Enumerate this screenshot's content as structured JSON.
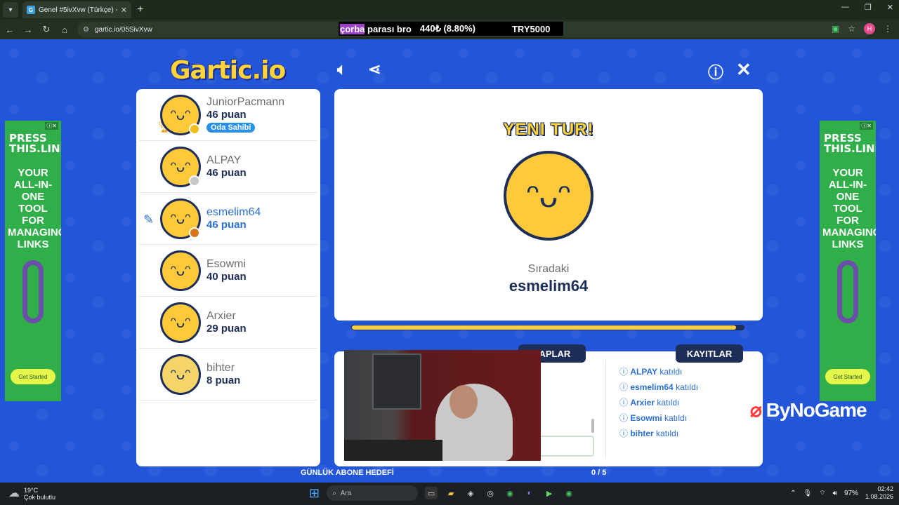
{
  "browser": {
    "tab_title": "Genel #5ivXvw (Türkçe) - G",
    "url": "gartic.io/05SivXvw",
    "ticker_highlight": "çorba",
    "ticker_text": " parası bro",
    "ticker_amount": "440₺ (8.80%)",
    "ticker_goal": "TRY5000",
    "profile_initial": "H"
  },
  "game": {
    "logo": "Gartic.io",
    "round_title": "YENI TUR!",
    "next_label": "Sıradaki",
    "next_player": "esmelim64",
    "owner_badge": "Oda Sahibi",
    "progress_fraction": 0.98,
    "tabs": {
      "answers": "VAPLAR",
      "logs": "KAYITLAR"
    },
    "players": [
      {
        "name": "JuniorPacmann",
        "score": "46 puan",
        "dot": "#f2c01d"
      },
      {
        "name": "ALPAY",
        "score": "46 puan",
        "dot": "#c8c8c8"
      },
      {
        "name": "esmelim64",
        "score": "46 puan",
        "dot": "#d8741a"
      },
      {
        "name": "Esowmi",
        "score": "40 puan",
        "dot": ""
      },
      {
        "name": "Arxier",
        "score": "29 puan",
        "dot": ""
      },
      {
        "name": "bihter",
        "score": "8 puan",
        "dot": ""
      }
    ],
    "log": [
      {
        "name": "ALPAY",
        "action": "katıldı"
      },
      {
        "name": "esmelim64",
        "action": "katıldı"
      },
      {
        "name": "Arxier",
        "action": "katıldı"
      },
      {
        "name": "Esowmi",
        "action": "katıldı"
      },
      {
        "name": "bihter",
        "action": "katıldı"
      }
    ]
  },
  "stream": {
    "sub_goal": "GÜNLÜK ABONE HEDEFİ",
    "sub_count": "0 / 5",
    "sponsor": "ByNoGame"
  },
  "ads": {
    "headline": "PRESS THIS.LINK",
    "body": "YOUR ALL-IN-ONE TOOL FOR MANAGING LINKS",
    "cta": "Get Started"
  },
  "taskbar": {
    "temp": "19°C",
    "weather": "Çok bulutlu",
    "search": "Ara",
    "battery": "97%",
    "time": "02:42",
    "date": "1.08.2026"
  }
}
